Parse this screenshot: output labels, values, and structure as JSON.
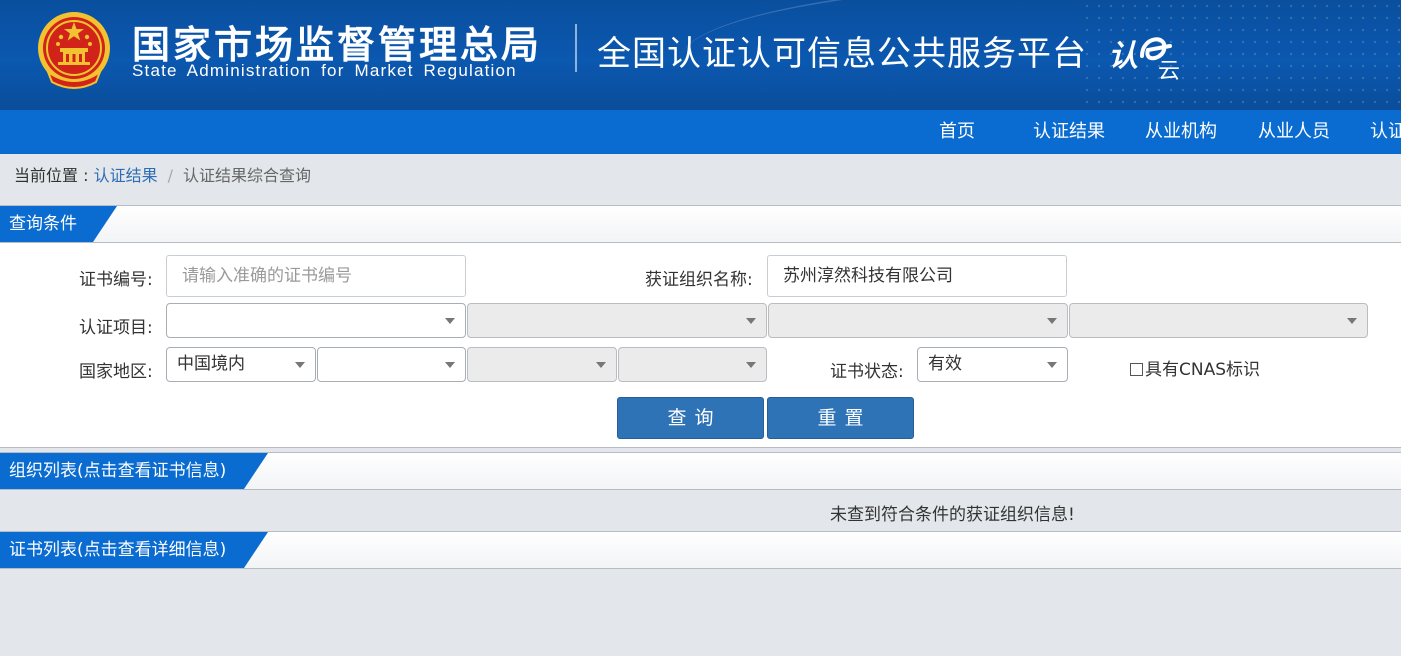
{
  "header": {
    "agency_cn": "国家市场监督管理总局",
    "agency_en": "State Administration  for  Market Regulation",
    "platform_title": "全国认证认可信息公共服务平台",
    "platform_logo_text": "认e云",
    "colors": {
      "header_bg": "#0b58b0",
      "nav_bg": "#0a6cd0",
      "emblem_red": "#d1231a",
      "emblem_gold": "#f2c230"
    }
  },
  "nav": {
    "items": [
      {
        "label": "首页"
      },
      {
        "label": "认证结果"
      },
      {
        "label": "从业机构"
      },
      {
        "label": "从业人员"
      },
      {
        "label": "认证"
      }
    ]
  },
  "breadcrumb": {
    "prefix": "当前位置 : ",
    "link": "认证结果",
    "separator": "/",
    "current": "认证结果综合查询"
  },
  "query": {
    "title": "查询条件",
    "cert_no_label": "证书编号:",
    "cert_no_placeholder": "请输入准确的证书编号",
    "cert_no_value": "",
    "org_name_label": "获证组织名称:",
    "org_name_value": "苏州淳然科技有限公司",
    "project_label": "认证项目:",
    "project_selects": [
      "",
      "",
      "",
      ""
    ],
    "region_label": "国家地区:",
    "region_selects": [
      "中国境内",
      "",
      "",
      ""
    ],
    "status_label": "证书状态:",
    "status_value": "有效",
    "cnas_label": "具有CNAS标识",
    "cnas_checked": false,
    "search_button": "查询",
    "reset_button": "重置"
  },
  "org_list": {
    "title": "组织列表(点击查看证书信息)",
    "empty_message": "未查到符合条件的获证组织信息!"
  },
  "cert_list": {
    "title": "证书列表(点击查看详细信息)"
  }
}
